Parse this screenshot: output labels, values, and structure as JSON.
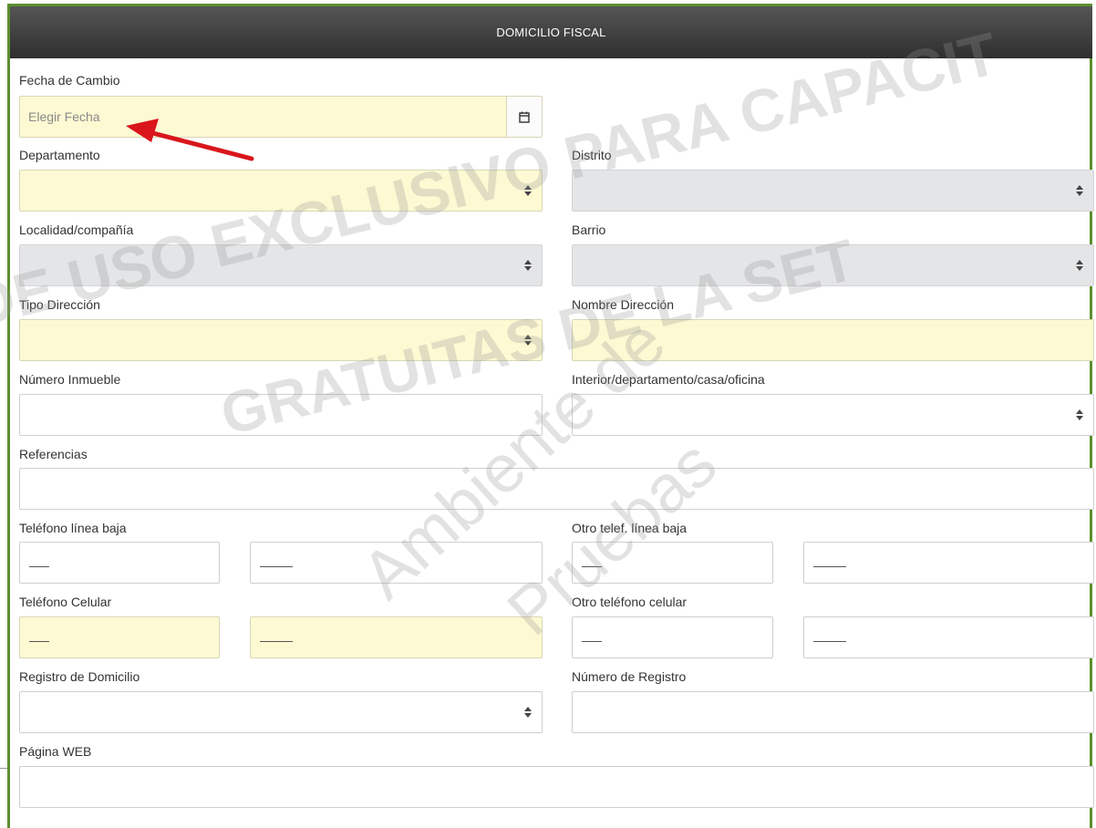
{
  "header": {
    "title": "DOMICILIO FISCAL"
  },
  "fields": {
    "fecha_cambio": {
      "label": "Fecha de Cambio",
      "placeholder": "Elegir Fecha"
    },
    "departamento": {
      "label": "Departamento"
    },
    "distrito": {
      "label": "Distrito"
    },
    "localidad": {
      "label": "Localidad/compañía"
    },
    "barrio": {
      "label": "Barrio"
    },
    "tipo_direccion": {
      "label": "Tipo Dirección"
    },
    "nombre_direccion": {
      "label": "Nombre Dirección"
    },
    "numero_inmueble": {
      "label": "Número Inmueble"
    },
    "interior": {
      "label": "Interior/departamento/casa/oficina"
    },
    "referencias": {
      "label": "Referencias"
    },
    "telefono_linea_baja": {
      "label": "Teléfono línea baja"
    },
    "otro_telef_linea_baja": {
      "label": "Otro telef. línea baja"
    },
    "telefono_celular": {
      "label": "Teléfono Celular"
    },
    "otro_telefono_celular": {
      "label": "Otro teléfono celular"
    },
    "registro_domicilio": {
      "label": "Registro de Domicilio"
    },
    "numero_registro": {
      "label": "Número de Registro"
    },
    "pagina_web": {
      "label": "Página WEB"
    }
  },
  "watermark": {
    "line1": "DE USO EXCLUSIVO PARA CAPACIT",
    "line2": "GRATUITAS DE LA SET",
    "line3": "Ambiente de",
    "line4": "Pruebas"
  },
  "colors": {
    "frame_border": "#5d8f2e",
    "header_bg": "#3a3a3a",
    "required_bg": "#fdf9d3",
    "disabled_bg": "#e4e5e7",
    "arrow": "#d9161c"
  },
  "icons": {
    "calendar": "calendar-icon",
    "select": "sort-caret-icon",
    "annotation": "red-arrow-icon"
  }
}
